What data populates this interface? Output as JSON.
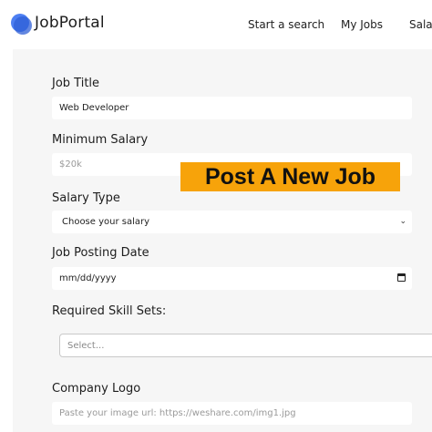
{
  "header": {
    "brand": "JobPortal",
    "nav": [
      "Start a search",
      "My Jobs",
      "Salar"
    ]
  },
  "form": {
    "job_title": {
      "label": "Job Title",
      "value": "Web Developer"
    },
    "min_salary": {
      "label": "Minimum Salary",
      "placeholder": "$20k"
    },
    "salary_type": {
      "label": "Salary Type",
      "selected": "Choose your salary"
    },
    "posting_date": {
      "label": "Job Posting Date",
      "placeholder": "mm/dd/yyyy"
    },
    "skills": {
      "label": "Required Skill Sets:",
      "placeholder": "Select..."
    },
    "company_logo": {
      "label": "Company Logo",
      "placeholder": "Paste your image url: https://weshare.com/img1.jpg"
    }
  },
  "banner": {
    "text": "Post A New Job"
  },
  "colors": {
    "accent": "#f7a30a",
    "logo": "#4d7ff2",
    "panel": "#f6f6f6"
  }
}
